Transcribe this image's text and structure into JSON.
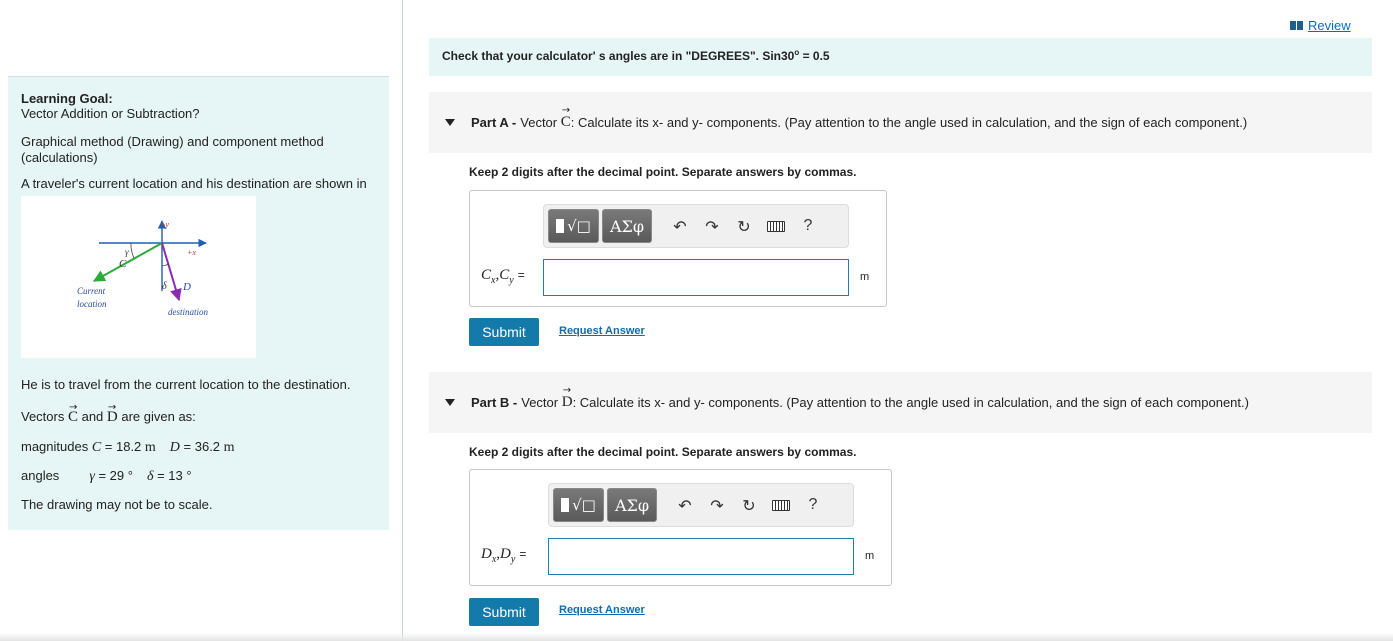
{
  "review": {
    "label": "Review",
    "icon": "book-icon"
  },
  "calc_banner": {
    "text_before": "Check that your calculator' s angles are in \"DEGREES\". Sin30",
    "sup": "o",
    "text_after": " = 0.5"
  },
  "goal": {
    "title": "Learning Goal:",
    "subtitle": "Vector Addition or Subtraction?",
    "method_line1": "Graphical method (Drawing)  and component method",
    "method_line2": "(calculations)",
    "traveler": "A traveler's current location and his destination are shown in",
    "figure": {
      "plus_y": "+y",
      "plus_x": "+x",
      "vec_c": "C",
      "vec_d": "D",
      "gamma": "γ",
      "delta": "δ",
      "current_line1": "Current",
      "current_line2": "location",
      "destination": "destination",
      "colors": {
        "axes": "#1f5fb0",
        "vec_c": "#2bab3a",
        "vec_d": "#8a2bb5",
        "label": "#2e4aa0"
      }
    },
    "travel": "He is to travel from the current location to the destination.",
    "vectors_prefix": "Vectors ",
    "vectors_c": "C",
    "vectors_and": " and ",
    "vectors_d": "D",
    "vectors_suffix": " are given as:",
    "magnitudes_label": "magnitudes ",
    "mag_c_sym": "C",
    "mag_c_val": " = 18.2 ",
    "mag_c_unit": "m",
    "mag_d_sym": "D",
    "mag_d_val": " = 36.2 ",
    "mag_d_unit": "m",
    "angles_label": "angles",
    "gamma_sym": "γ",
    "gamma_val": " = 29 °",
    "delta_sym": "δ",
    "delta_val": " = 13 °",
    "scale_note": "The drawing may not be to scale."
  },
  "parts": [
    {
      "label": "Part A - ",
      "text_before": "Vector ",
      "vec": "C",
      "text_after": ": Calculate its x- and y- components. (Pay attention to the angle used in calculation, and the sign of each component.)",
      "instruction": "Keep 2 digits after the decimal point. Separate answers by commas.",
      "answer_main": "C",
      "sub_x": "x",
      "answer_sep": ",C",
      "sub_y": "y",
      "eq": "=",
      "unit": "m",
      "submit": "Submit",
      "request": "Request Answer"
    },
    {
      "label": "Part B - ",
      "text_before": "Vector ",
      "vec": "D",
      "text_after": ": Calculate its x- and y- components. (Pay attention to the angle used in calculation, and the sign of each component.)",
      "instruction": "Keep 2 digits after the decimal point. Separate answers by commas.",
      "answer_main": "D",
      "sub_x": "x",
      "answer_sep": ",D",
      "sub_y": "y",
      "eq": "=",
      "unit": "m",
      "submit": "Submit",
      "request": "Request Answer"
    }
  ],
  "toolbar": {
    "templates_icon": "templates-sqrt-icon",
    "symbols_label": "ΑΣφ",
    "undo_icon": "undo-icon",
    "redo_icon": "redo-icon",
    "reset_icon": "reset-icon",
    "keyboard_icon": "keyboard-icon",
    "help_label": "?"
  }
}
